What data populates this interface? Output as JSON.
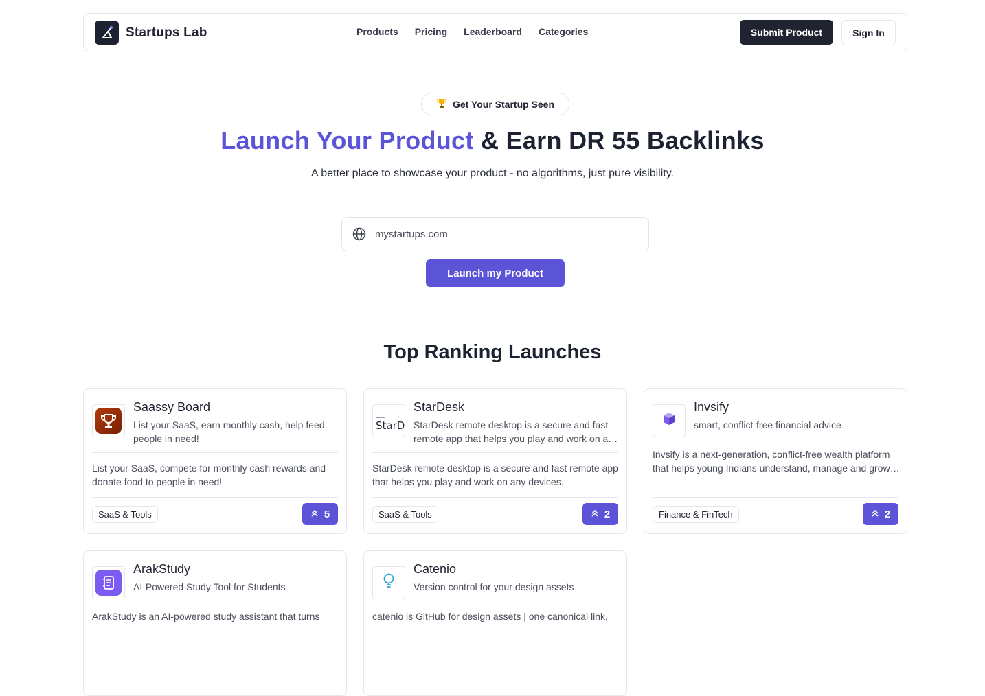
{
  "header": {
    "brand": "Startups Lab",
    "nav": [
      "Products",
      "Pricing",
      "Leaderboard",
      "Categories"
    ],
    "submit_label": "Submit Product",
    "signin_label": "Sign In"
  },
  "hero": {
    "pill": "Get Your Startup Seen",
    "title_accent": "Launch Your Product",
    "title_rest": " & Earn DR 55 Backlinks",
    "subtitle": "A better place to showcase your product - no algorithms, just pure visibility.",
    "url_placeholder": "mystartups.com",
    "launch_label": "Launch my Product"
  },
  "section": {
    "title": "Top Ranking Launches"
  },
  "cards": [
    {
      "name": "Saassy Board",
      "tagline": "List your SaaS, earn monthly cash, help feed people in need!",
      "description": "List your SaaS, compete for monthly cash rewards and donate food to people in need!",
      "tag": "SaaS & Tools",
      "votes": "5",
      "icon": "trophy-icon"
    },
    {
      "name": "StarDesk",
      "tagline": "StarDesk remote desktop is a secure and fast remote app that helps you play and work on any devices.",
      "description": "StarDesk remote desktop is a secure and fast remote app that helps you play and work on any devices.",
      "tag": "SaaS & Tools",
      "votes": "2",
      "icon_alt": "StarD"
    },
    {
      "name": "Invsify",
      "tagline": "smart, conflict-free financial advice",
      "description": "Invsify is a next-generation, conflict-free wealth platform that helps young Indians understand, manage and grow their wealth.",
      "tag": "Finance & FinTech",
      "votes": "2",
      "icon": "cube-logo-icon"
    },
    {
      "name": "ArakStudy",
      "tagline": "AI-Powered Study Tool for Students",
      "description": "ArakStudy is an AI-powered study assistant that turns",
      "icon": "notebook-icon"
    },
    {
      "name": "Catenio",
      "tagline": "Version control for your design assets",
      "description": "catenio is GitHub for design assets | one canonical link,",
      "icon": "bulb-icon"
    }
  ],
  "colors": {
    "accent": "#5b54d6",
    "dark": "#1f2430",
    "border": "#e5e7eb"
  }
}
